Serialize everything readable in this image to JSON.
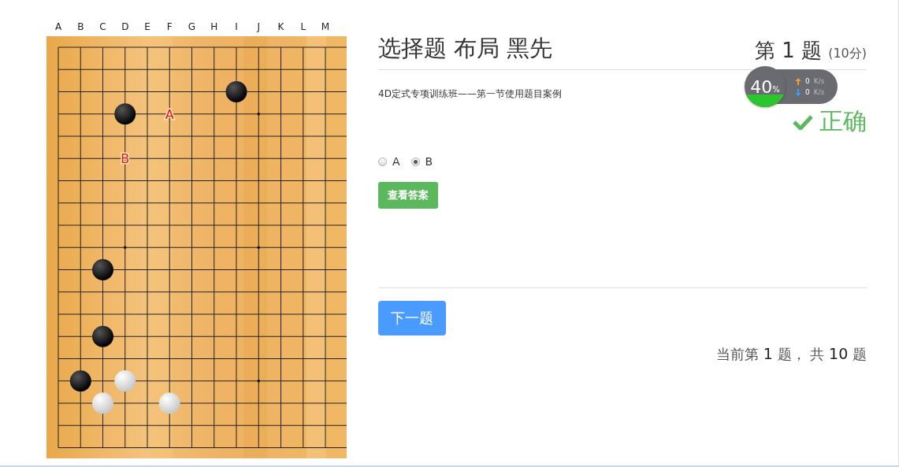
{
  "board": {
    "column_labels": [
      "A",
      "B",
      "C",
      "D",
      "E",
      "F",
      "G",
      "H",
      "I",
      "J",
      "K",
      "L",
      "M"
    ],
    "markers": [
      {
        "label": "A"
      },
      {
        "label": "B"
      }
    ]
  },
  "question": {
    "title": "选择题 布局 黑先",
    "number": "第 1 题",
    "points": "(10分)",
    "description": "4D定式专项训练班——第一节使用题目案例",
    "result": "正确",
    "correct": true,
    "options": [
      {
        "label": "A",
        "selected": false
      },
      {
        "label": "B",
        "selected": true
      }
    ],
    "answer_button": "查看答案",
    "next_button": "下一题",
    "progress": "当前第 **1** 题， 共 **10** 题"
  },
  "speed_widget": {
    "percent": "40",
    "unit": "%",
    "upload": "0",
    "upload_unit": "K/s",
    "download": "0",
    "download_unit": "K/s"
  }
}
